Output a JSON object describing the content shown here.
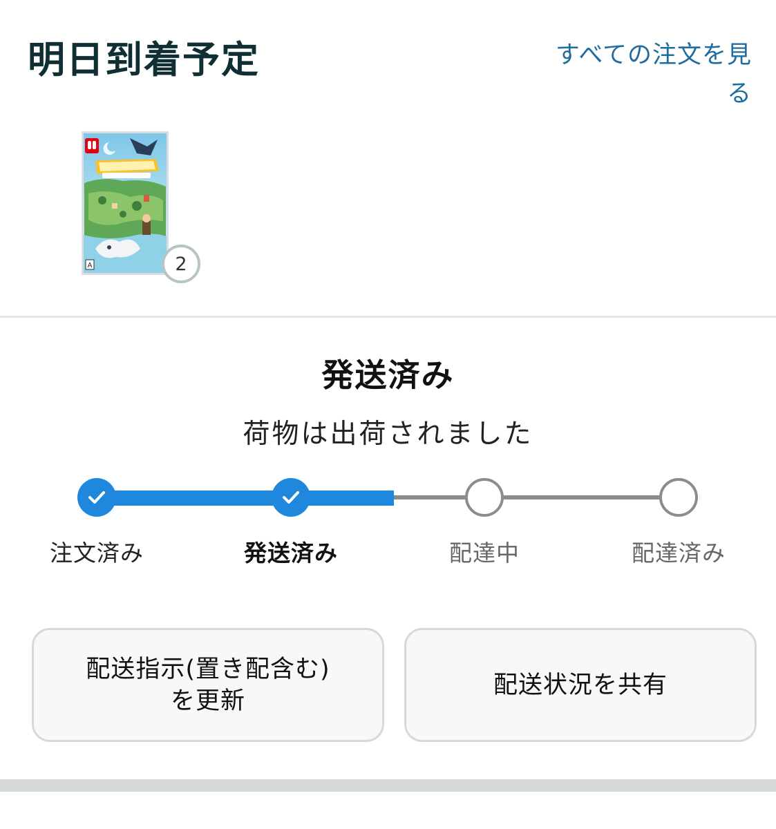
{
  "header": {
    "title": "明日到着予定",
    "view_all_orders": "すべての注文を見る"
  },
  "product": {
    "image_name": "game-box-cover",
    "quantity": "2"
  },
  "status": {
    "title": "発送済み",
    "subtitle": "荷物は出荷されました"
  },
  "tracker": {
    "progress_fraction": 0.5,
    "steps": [
      {
        "label": "注文済み",
        "state": "done"
      },
      {
        "label": "発送済み",
        "state": "current"
      },
      {
        "label": "配達中",
        "state": "pending"
      },
      {
        "label": "配達済み",
        "state": "pending"
      }
    ]
  },
  "actions": {
    "update_instructions_line1": "配送指示(置き配含む)",
    "update_instructions_line2": "を更新",
    "share_status": "配送状況を共有"
  },
  "colors": {
    "accent_blue": "#1f87dc",
    "link_blue": "#1f6c9f",
    "title_dark": "#0f2f35",
    "pending_gray": "#8c8c8c"
  }
}
